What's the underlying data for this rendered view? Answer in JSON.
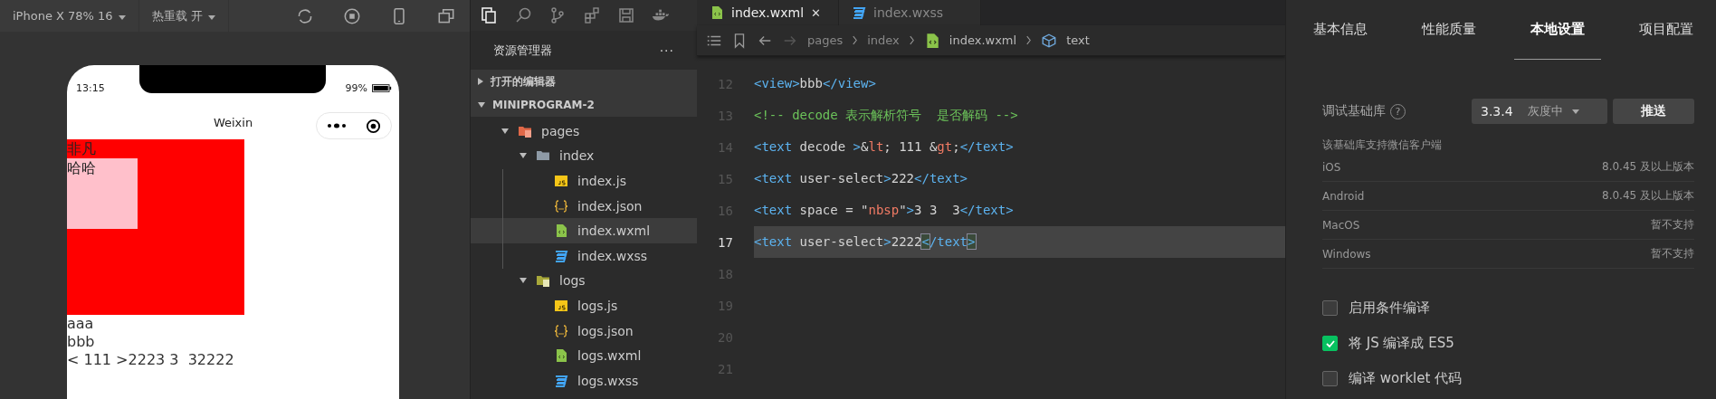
{
  "simulator": {
    "device": "iPhone X 78% 16",
    "hot_reload": "热重载 开",
    "phone": {
      "time": "13:15",
      "battery": "99%",
      "nav_title": "Weixin",
      "outer_text": "非凡",
      "inner_text": "哈哈",
      "lines": [
        "aaa",
        "bbb",
        "< 111 >2223 3  32222"
      ]
    }
  },
  "explorer": {
    "title": "资源管理器",
    "more": "···",
    "sections": [
      {
        "label": "打开的编辑器",
        "expanded": false
      },
      {
        "label": "MINIPROGRAM-2",
        "expanded": true
      }
    ],
    "tree": [
      {
        "name": "pages",
        "kind": "folder-pages",
        "expanded": true,
        "selected": false,
        "children": [
          {
            "name": "index",
            "kind": "folder",
            "expanded": true,
            "selected": false,
            "children": [
              {
                "name": "index.js",
                "kind": "js",
                "selected": false
              },
              {
                "name": "index.json",
                "kind": "json",
                "selected": false
              },
              {
                "name": "index.wxml",
                "kind": "wxml",
                "selected": true
              },
              {
                "name": "index.wxss",
                "kind": "wxss",
                "selected": false
              }
            ]
          },
          {
            "name": "logs",
            "kind": "folder-logs",
            "expanded": true,
            "selected": false,
            "children": [
              {
                "name": "logs.js",
                "kind": "js",
                "selected": false
              },
              {
                "name": "logs.json",
                "kind": "json",
                "selected": false
              },
              {
                "name": "logs.wxml",
                "kind": "wxml",
                "selected": false
              },
              {
                "name": "logs.wxss",
                "kind": "wxss",
                "selected": false
              }
            ]
          }
        ]
      }
    ]
  },
  "editor": {
    "tabs": [
      {
        "label": "index.wxml",
        "kind": "wxml",
        "selected": true,
        "close": "✕"
      },
      {
        "label": "index.wxss",
        "kind": "wxss",
        "selected": false
      }
    ],
    "breadcrumb": [
      {
        "label": "pages",
        "kind": "text"
      },
      {
        "label": "index",
        "kind": "text"
      },
      {
        "label": "index.wxml",
        "kind": "wxml"
      },
      {
        "label": "text",
        "kind": "element"
      }
    ],
    "lines": [
      {
        "number": "12",
        "current": false,
        "tokens": [
          {
            "t": "<view>",
            "kind": "tag"
          },
          {
            "t": "bbb",
            "kind": "text"
          },
          {
            "t": "</view>",
            "kind": "tag"
          }
        ]
      },
      {
        "number": "13",
        "current": false,
        "tokens": [
          {
            "t": "<!-- decode 表示解析符号  是否解码 -->",
            "kind": "comment"
          }
        ]
      },
      {
        "number": "14",
        "current": false,
        "tokens": [
          {
            "t": "<text",
            "kind": "tag"
          },
          {
            "t": " decode ",
            "kind": "attr"
          },
          {
            "t": ">",
            "kind": "tag"
          },
          {
            "t": "&",
            "kind": "text"
          },
          {
            "t": "lt",
            "kind": "entity"
          },
          {
            "t": "; 111 &",
            "kind": "text"
          },
          {
            "t": "gt",
            "kind": "entity"
          },
          {
            "t": ";",
            "kind": "text"
          },
          {
            "t": "</text>",
            "kind": "tag"
          }
        ]
      },
      {
        "number": "15",
        "current": false,
        "tokens": [
          {
            "t": "<text",
            "kind": "tag"
          },
          {
            "t": " user-select",
            "kind": "attr"
          },
          {
            "t": ">",
            "kind": "tag"
          },
          {
            "t": "222",
            "kind": "text"
          },
          {
            "t": "</text>",
            "kind": "tag"
          }
        ]
      },
      {
        "number": "16",
        "current": false,
        "tokens": [
          {
            "t": "<text",
            "kind": "tag"
          },
          {
            "t": " space = \"",
            "kind": "attr"
          },
          {
            "t": "nbsp",
            "kind": "entity"
          },
          {
            "t": "\"",
            "kind": "attr"
          },
          {
            "t": ">",
            "kind": "tag"
          },
          {
            "t": "3 3  3",
            "kind": "text"
          },
          {
            "t": "</text>",
            "kind": "tag"
          }
        ]
      },
      {
        "number": "17",
        "current": true,
        "tokens": [
          {
            "t": "<text",
            "kind": "tag"
          },
          {
            "t": " user-select",
            "kind": "attr"
          },
          {
            "t": ">",
            "kind": "tag"
          },
          {
            "t": "2222",
            "kind": "text"
          },
          {
            "t": "<",
            "kind": "match"
          },
          {
            "t": "/text",
            "kind": "tag"
          },
          {
            "t": ">",
            "kind": "match"
          }
        ]
      },
      {
        "number": "18",
        "current": false
      },
      {
        "number": "19",
        "current": false
      },
      {
        "number": "20",
        "current": false
      },
      {
        "number": "21",
        "current": false
      }
    ]
  },
  "settings": {
    "tabs": [
      {
        "label": "基本信息",
        "selected": false
      },
      {
        "label": "性能质量",
        "selected": false
      },
      {
        "label": "本地设置",
        "selected": true
      },
      {
        "label": "项目配置",
        "selected": false
      }
    ],
    "library_label": "调试基础库",
    "help": "?",
    "library_version": "3.3.4",
    "library_channel": "灰度中",
    "push_button": "推送",
    "support_title": "该基础库支持微信客户端",
    "support": [
      {
        "platform": "iOS",
        "requirement": "8.0.45 及以上版本"
      },
      {
        "platform": "Android",
        "requirement": "8.0.45 及以上版本"
      },
      {
        "platform": "MacOS",
        "requirement": "暂不支持"
      },
      {
        "platform": "Windows",
        "requirement": "暂不支持"
      }
    ],
    "options": [
      {
        "label": "启用条件编译",
        "checked": false
      },
      {
        "label": "将 JS 编译成 ES5",
        "checked": true
      },
      {
        "label": "编译 worklet 代码",
        "checked": false
      }
    ]
  }
}
